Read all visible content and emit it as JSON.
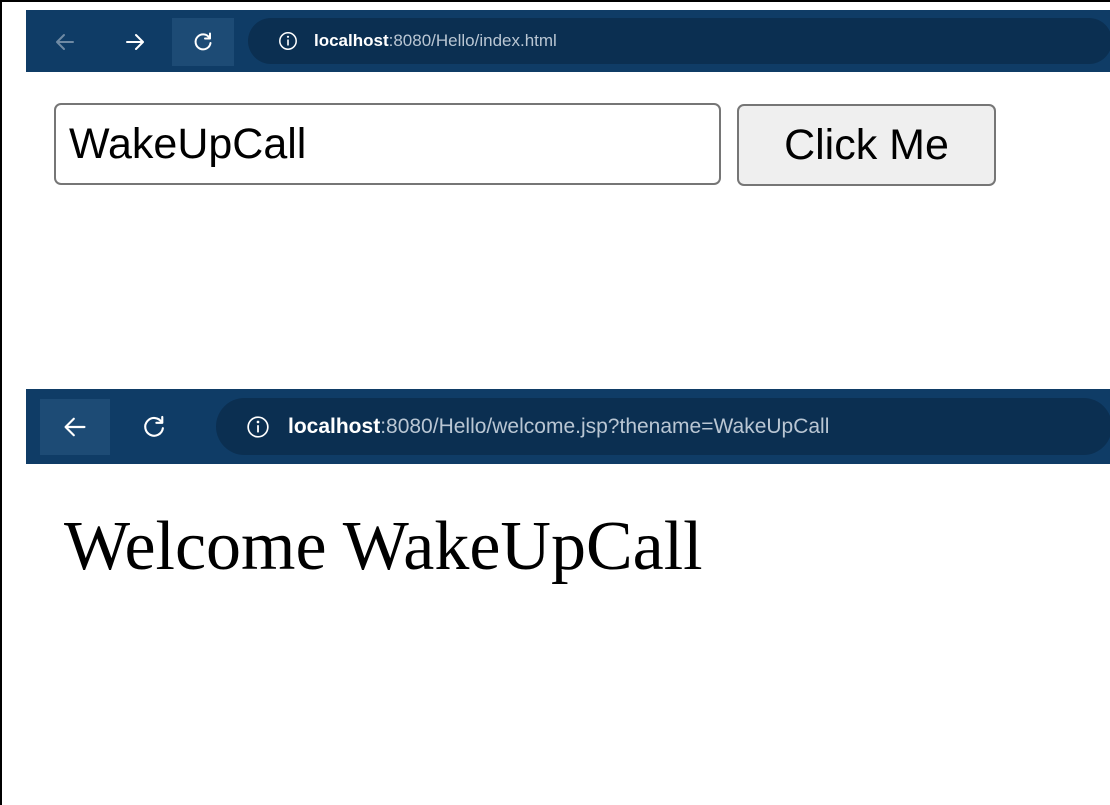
{
  "browser_top": {
    "icons": {
      "back": "arrow-left-icon",
      "forward": "arrow-right-icon",
      "reload": "reload-icon",
      "info": "info-icon"
    },
    "url_host": "localhost",
    "url_path": ":8080/Hello/index.html"
  },
  "form": {
    "name_value": "WakeUpCall",
    "button_label": "Click Me"
  },
  "browser_bottom": {
    "icons": {
      "back": "arrow-left-icon",
      "reload": "reload-icon",
      "info": "info-icon"
    },
    "url_host": "localhost",
    "url_path": ":8080/Hello/welcome.jsp?thename=WakeUpCall"
  },
  "welcome_page": {
    "message": "Welcome WakeUpCall"
  },
  "colors": {
    "toolbar": "#0f3c66",
    "url_bar": "#0b2f51",
    "url_host": "#ffffff",
    "url_path": "#b9c6d3"
  }
}
